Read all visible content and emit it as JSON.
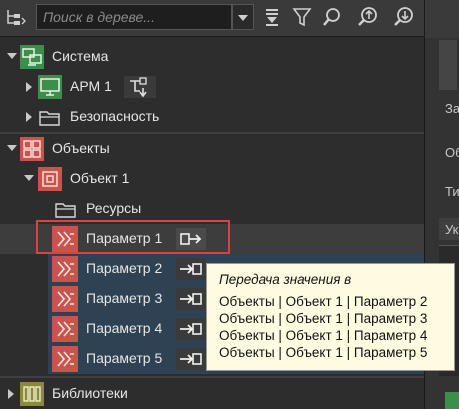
{
  "toolbar": {
    "search_placeholder": "Поиск в дереве...",
    "buttons": [
      "sort-down-icon",
      "filter-icon",
      "zoom-icon",
      "navigate-up-icon",
      "navigate-down-icon"
    ]
  },
  "tree": {
    "sistema": {
      "label": "Система",
      "children": [
        {
          "label": "АРМ 1"
        },
        {
          "label": "Безопасность"
        }
      ]
    },
    "obekty": {
      "label": "Объекты",
      "object1": {
        "label": "Объект 1",
        "resources": {
          "label": "Ресурсы"
        },
        "params": [
          {
            "label": "Параметр 1"
          },
          {
            "label": "Параметр 2"
          },
          {
            "label": "Параметр 3"
          },
          {
            "label": "Параметр 4"
          },
          {
            "label": "Параметр 5"
          }
        ]
      }
    },
    "biblioteki": {
      "label": "Библиотеки"
    }
  },
  "tooltip": {
    "title": "Передача значения в",
    "lines": [
      "Объекты | Объект 1 | Параметр 2",
      "Объекты | Объект 1 | Параметр 3",
      "Объекты | Объект 1 | Параметр 4",
      "Объекты | Объект 1 | Параметр 5"
    ]
  },
  "right_panel": {
    "fragments": [
      "За",
      "Об",
      "Ти",
      "Ук"
    ]
  },
  "colors": {
    "accent_red": "#e0413f",
    "node_green": "#3c8f4b",
    "node_red": "#c9544e",
    "highlight_blue": "#2f4253",
    "tooltip_bg": "#fffce1"
  }
}
